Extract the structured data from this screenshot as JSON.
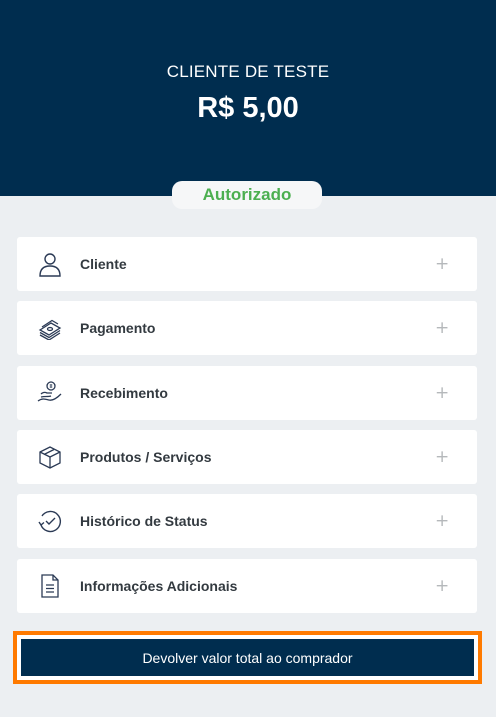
{
  "header": {
    "client_name": "CLIENTE DE TESTE",
    "amount": "R$ 5,00"
  },
  "status": {
    "label": "Autorizado",
    "color": "#4caf50"
  },
  "sections": [
    {
      "label": "Cliente",
      "icon": "user-icon"
    },
    {
      "label": "Pagamento",
      "icon": "money-stack-icon"
    },
    {
      "label": "Recebimento",
      "icon": "hand-receive-icon"
    },
    {
      "label": "Produtos / Serviços",
      "icon": "box-icon"
    },
    {
      "label": "Histórico de Status",
      "icon": "history-icon"
    },
    {
      "label": "Informações Adicionais",
      "icon": "document-icon"
    }
  ],
  "expand_symbol": "+",
  "refund_button": {
    "label": "Devolver valor total ao comprador"
  },
  "colors": {
    "header_bg": "#002d4f",
    "page_bg": "#eceff2",
    "highlight": "#ff7a00"
  }
}
